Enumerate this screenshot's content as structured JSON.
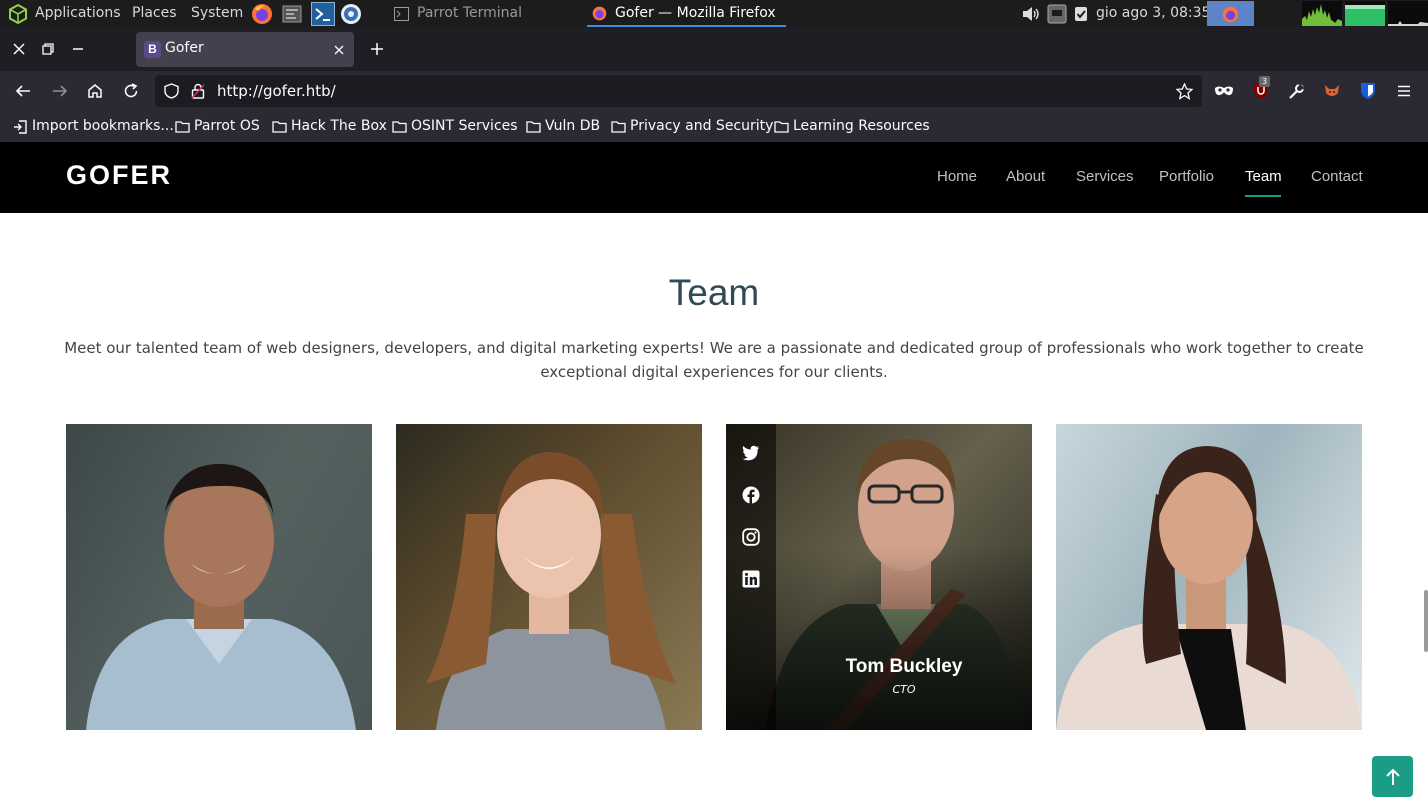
{
  "os_panel": {
    "applications": "Applications",
    "places": "Places",
    "system": "System",
    "task_terminal": "Parrot Terminal",
    "task_firefox": "Gofer — Mozilla Firefox",
    "clock": "gio ago  3, 08:35"
  },
  "browser": {
    "tab_title": "Gofer",
    "tab_favicon_letter": "B",
    "url": "http://gofer.htb/",
    "ublock_count": "3",
    "bookmarks": [
      "Import bookmarks...",
      "Parrot OS",
      "Hack The Box",
      "OSINT Services",
      "Vuln DB",
      "Privacy and Security",
      "Learning Resources"
    ]
  },
  "site": {
    "logo": "GOFER",
    "nav": [
      "Home",
      "About",
      "Services",
      "Portfolio",
      "Team",
      "Contact"
    ],
    "active_nav": "Team",
    "accent_color": "#1a9c85"
  },
  "team": {
    "title": "Team",
    "description": "Meet our talented team of web designers, developers, and digital marketing experts! We are a passionate and dedicated group of professionals who work together to create exceptional digital experiences for our clients.",
    "hovered_member": {
      "name": "Tom Buckley",
      "role": "CTO"
    }
  }
}
